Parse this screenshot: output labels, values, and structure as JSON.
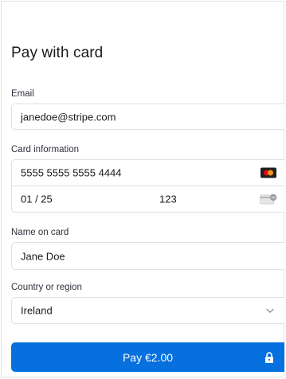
{
  "title": "Pay with card",
  "email": {
    "label": "Email",
    "value": "janedoe@stripe.com"
  },
  "card": {
    "label": "Card information",
    "number": "5555 5555 5555 4444",
    "expiry": "01 / 25",
    "cvc": "123",
    "brand_icon": "mastercard-icon",
    "cvc_icon": "card-cvc-icon"
  },
  "name": {
    "label": "Name on card",
    "value": "Jane Doe"
  },
  "country": {
    "label": "Country or region",
    "selected": "Ireland"
  },
  "pay": {
    "label": "Pay €2.00",
    "icon": "lock-icon"
  },
  "colors": {
    "accent": "#0570de",
    "border": "#e0e0e0",
    "text": "#30313d"
  }
}
